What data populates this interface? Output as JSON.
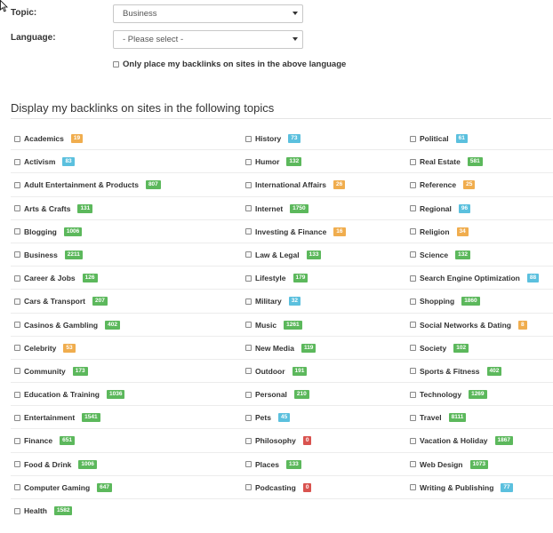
{
  "form": {
    "topic_label": "Topic:",
    "topic_value": "Business",
    "language_label": "Language:",
    "language_value": "- Please select -",
    "language_only_label": "Only place my backlinks on sites in the above language"
  },
  "section_title": "Display my backlinks on sites in the following topics",
  "colors": {
    "green": "#5cb85c",
    "blue": "#5bc0de",
    "orange": "#f0ad4e",
    "red": "#d9534f"
  },
  "topics": [
    [
      {
        "name": "Academics",
        "count": "19",
        "color": "orange"
      },
      {
        "name": "History",
        "count": "73",
        "color": "blue"
      },
      {
        "name": "Political",
        "count": "61",
        "color": "blue"
      }
    ],
    [
      {
        "name": "Activism",
        "count": "83",
        "color": "blue"
      },
      {
        "name": "Humor",
        "count": "132",
        "color": "green"
      },
      {
        "name": "Real Estate",
        "count": "581",
        "color": "green"
      }
    ],
    [
      {
        "name": "Adult Entertainment & Products",
        "count": "807",
        "color": "green"
      },
      {
        "name": "International Affairs",
        "count": "26",
        "color": "orange"
      },
      {
        "name": "Reference",
        "count": "25",
        "color": "orange"
      }
    ],
    [
      {
        "name": "Arts & Crafts",
        "count": "131",
        "color": "green"
      },
      {
        "name": "Internet",
        "count": "1750",
        "color": "green"
      },
      {
        "name": "Regional",
        "count": "96",
        "color": "blue"
      }
    ],
    [
      {
        "name": "Blogging",
        "count": "1006",
        "color": "green"
      },
      {
        "name": "Investing & Finance",
        "count": "16",
        "color": "orange"
      },
      {
        "name": "Religion",
        "count": "34",
        "color": "orange"
      }
    ],
    [
      {
        "name": "Business",
        "count": "2211",
        "color": "green"
      },
      {
        "name": "Law & Legal",
        "count": "133",
        "color": "green"
      },
      {
        "name": "Science",
        "count": "132",
        "color": "green"
      }
    ],
    [
      {
        "name": "Career & Jobs",
        "count": "126",
        "color": "green"
      },
      {
        "name": "Lifestyle",
        "count": "179",
        "color": "green"
      },
      {
        "name": "Search Engine Optimization",
        "count": "88",
        "color": "blue"
      }
    ],
    [
      {
        "name": "Cars & Transport",
        "count": "207",
        "color": "green"
      },
      {
        "name": "Military",
        "count": "32",
        "color": "blue"
      },
      {
        "name": "Shopping",
        "count": "1860",
        "color": "green"
      }
    ],
    [
      {
        "name": "Casinos & Gambling",
        "count": "402",
        "color": "green"
      },
      {
        "name": "Music",
        "count": "1261",
        "color": "green"
      },
      {
        "name": "Social Networks & Dating",
        "count": "8",
        "color": "orange"
      }
    ],
    [
      {
        "name": "Celebrity",
        "count": "53",
        "color": "orange"
      },
      {
        "name": "New Media",
        "count": "119",
        "color": "green"
      },
      {
        "name": "Society",
        "count": "102",
        "color": "green"
      }
    ],
    [
      {
        "name": "Community",
        "count": "173",
        "color": "green"
      },
      {
        "name": "Outdoor",
        "count": "191",
        "color": "green"
      },
      {
        "name": "Sports & Fitness",
        "count": "402",
        "color": "green"
      }
    ],
    [
      {
        "name": "Education & Training",
        "count": "1036",
        "color": "green"
      },
      {
        "name": "Personal",
        "count": "210",
        "color": "green"
      },
      {
        "name": "Technology",
        "count": "1269",
        "color": "green"
      }
    ],
    [
      {
        "name": "Entertainment",
        "count": "1541",
        "color": "green"
      },
      {
        "name": "Pets",
        "count": "45",
        "color": "blue"
      },
      {
        "name": "Travel",
        "count": "8111",
        "color": "green"
      }
    ],
    [
      {
        "name": "Finance",
        "count": "651",
        "color": "green"
      },
      {
        "name": "Philosophy",
        "count": "0",
        "color": "red"
      },
      {
        "name": "Vacation & Holiday",
        "count": "1867",
        "color": "green"
      }
    ],
    [
      {
        "name": "Food & Drink",
        "count": "1006",
        "color": "green"
      },
      {
        "name": "Places",
        "count": "133",
        "color": "green"
      },
      {
        "name": "Web Design",
        "count": "1073",
        "color": "green"
      }
    ],
    [
      {
        "name": "Computer Gaming",
        "count": "647",
        "color": "green"
      },
      {
        "name": "Podcasting",
        "count": "0",
        "color": "red"
      },
      {
        "name": "Writing & Publishing",
        "count": "77",
        "color": "blue"
      }
    ],
    [
      {
        "name": "Health",
        "count": "1582",
        "color": "green"
      }
    ]
  ]
}
